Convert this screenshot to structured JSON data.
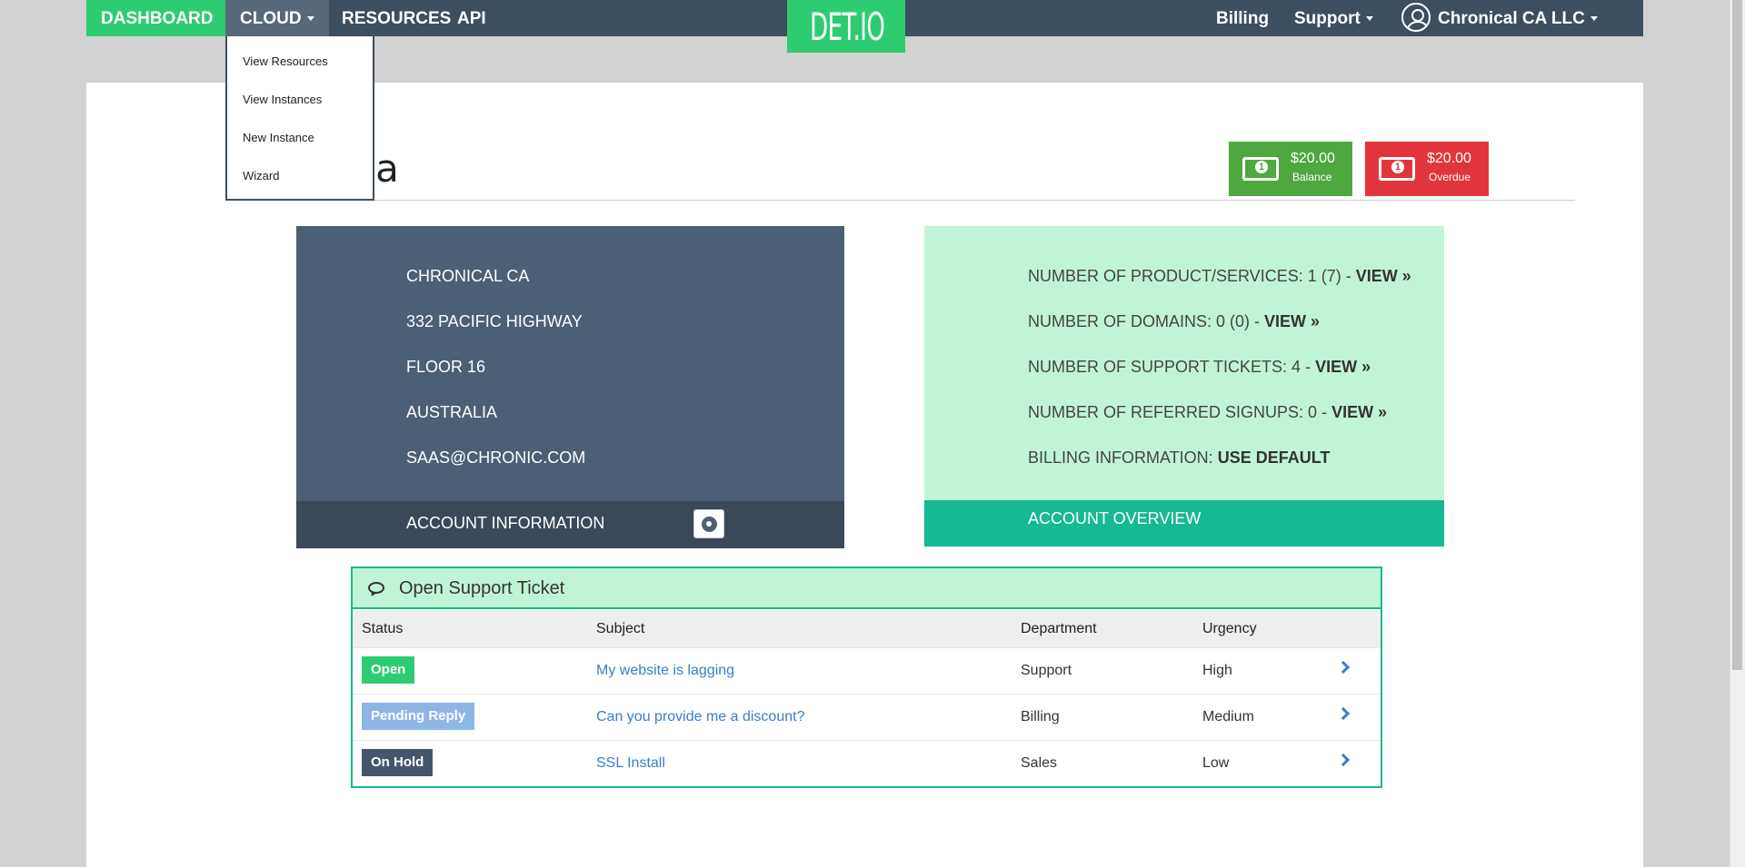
{
  "nav": {
    "dashboard": "DASHBOARD",
    "cloud": "CLOUD",
    "resources": "RESOURCES",
    "api": "API",
    "logo": "DET.IO",
    "billing": "Billing",
    "support": "Support",
    "account": "Chronical CA LLC"
  },
  "cloud_menu": [
    "View Resources",
    "View Instances",
    "New Instance",
    "Wizard"
  ],
  "page": {
    "title_partial": "rea"
  },
  "balance": {
    "amount": "$20.00",
    "label": "Balance"
  },
  "overdue": {
    "amount": "$20.00",
    "label": "Overdue"
  },
  "account_info": {
    "lines": [
      "CHRONICAL CA",
      "332 PACIFIC HIGHWAY",
      "FLOOR 16",
      "AUSTRALIA",
      "SAAS@CHRONIC.COM"
    ],
    "footer": "ACCOUNT INFORMATION"
  },
  "overview": {
    "products": "NUMBER OF PRODUCT/SERVICES: 1 (7) -",
    "domains": "NUMBER OF DOMAINS: 0 (0) -",
    "tickets": "NUMBER OF SUPPORT TICKETS: 4 -",
    "referred": "NUMBER OF REFERRED SIGNUPS: 0 -",
    "billing_label": "BILLING INFORMATION:",
    "billing_value": "USE DEFAULT",
    "view_link": "VIEW »",
    "footer": "ACCOUNT OVERVIEW"
  },
  "tickets": {
    "title": "Open Support Ticket",
    "columns": [
      "Status",
      "Subject",
      "Department",
      "Urgency"
    ],
    "rows": [
      {
        "status": "Open",
        "status_color": "#2ecc71",
        "subject": "My website is lagging",
        "department": "Support",
        "urgency": "High"
      },
      {
        "status": "Pending Reply",
        "status_color": "#8eb6e4",
        "subject": "Can you provide me a discount?",
        "department": "Billing",
        "urgency": "Medium"
      },
      {
        "status": "On Hold",
        "status_color": "#46566a",
        "subject": "SSL Install",
        "department": "Sales",
        "urgency": "Low"
      }
    ]
  },
  "colors": {
    "nav_bg": "#3d4e5e",
    "accent_green": "#2ecc71",
    "teal": "#16b994",
    "mint": "#bff5d6",
    "slate": "#4c5f74",
    "balance_green": "#4ea83f",
    "overdue_red": "#e2353b"
  }
}
